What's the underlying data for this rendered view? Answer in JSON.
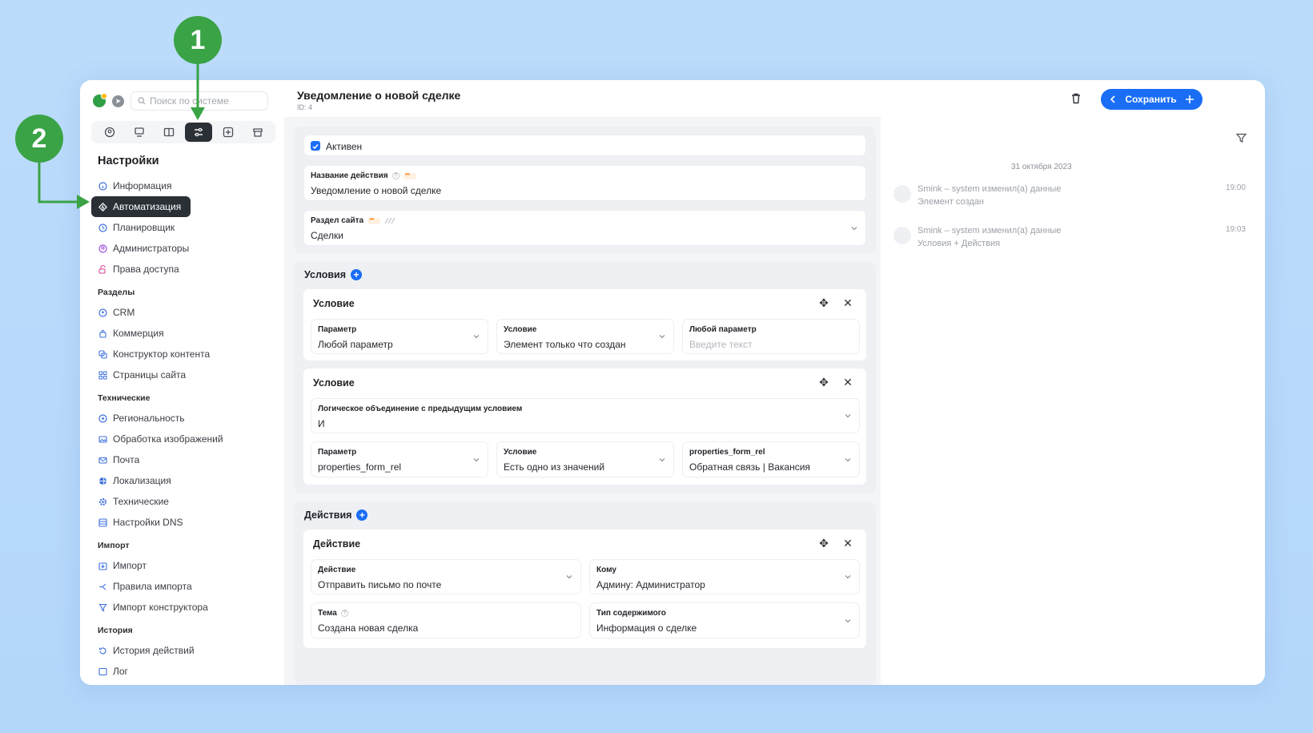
{
  "search": {
    "placeholder": "Поиск по системе"
  },
  "sidebar": {
    "title": "Настройки",
    "top_items": [
      {
        "label": "Информация",
        "icon": "info-icon"
      },
      {
        "label": "Автоматизация",
        "icon": "automation-icon"
      },
      {
        "label": "Планировщик",
        "icon": "scheduler-icon"
      },
      {
        "label": "Администраторы",
        "icon": "admins-icon"
      },
      {
        "label": "Права доступа",
        "icon": "access-icon"
      }
    ],
    "sections": [
      {
        "title": "Разделы",
        "items": [
          "CRM",
          "Коммерция",
          "Конструктор контента",
          "Страницы сайта"
        ]
      },
      {
        "title": "Технические",
        "items": [
          "Региональность",
          "Обработка изображений",
          "Почта",
          "Локализация",
          "Технические",
          "Настройки DNS"
        ]
      },
      {
        "title": "Импорт",
        "items": [
          "Импорт",
          "Правила импорта",
          "Импорт конструктора"
        ]
      },
      {
        "title": "История",
        "items": [
          "История действий",
          "Лог"
        ]
      }
    ]
  },
  "header": {
    "title": "Уведомление о новой сделке",
    "id": "ID: 4",
    "save_label": "Сохранить"
  },
  "general": {
    "active_label": "Активен",
    "name_label": "Название действия",
    "name_value": "Уведомление о новой сделке",
    "section_label": "Раздел сайта",
    "section_value": "Сделки"
  },
  "conditions": {
    "title": "Условия",
    "c1": {
      "title": "Условие",
      "param_label": "Параметр",
      "param_value": "Любой параметр",
      "cond_label": "Условие",
      "cond_value": "Элемент только что создан",
      "any_label": "Любой параметр",
      "any_placeholder": "Введите текст"
    },
    "c2": {
      "title": "Условие",
      "logic_label": "Логическое объединение с предыдущим условием",
      "logic_value": "И",
      "param_label": "Параметр",
      "param_value": "properties_form_rel",
      "cond_label": "Условие",
      "cond_value": "Есть одно из значений",
      "rel_label": "properties_form_rel",
      "rel_value": "Обратная связь | Вакансия"
    }
  },
  "actions": {
    "title": "Действия",
    "a1": {
      "title": "Действие",
      "action_label": "Действие",
      "action_value": "Отправить письмо по почте",
      "to_label": "Кому",
      "to_value": "Админу: Администратор",
      "subject_label": "Тема",
      "subject_value": "Создана новая сделка",
      "ctype_label": "Тип содержимого",
      "ctype_value": "Информация о сделке"
    }
  },
  "history": {
    "date": "31 октября 2023",
    "items": [
      {
        "line1": "Smink – system изменил(а) данные",
        "line2": "Элемент создан",
        "time": "19:00"
      },
      {
        "line1": "Smink – system изменил(а) данные",
        "line2": "Условия + Действия",
        "time": "19:03"
      }
    ]
  },
  "annotations": {
    "one": "1",
    "two": "2",
    "color": "#3aa346"
  },
  "colors": {
    "accent": "#1a6ef5",
    "active_nav": "#2b2f36"
  }
}
